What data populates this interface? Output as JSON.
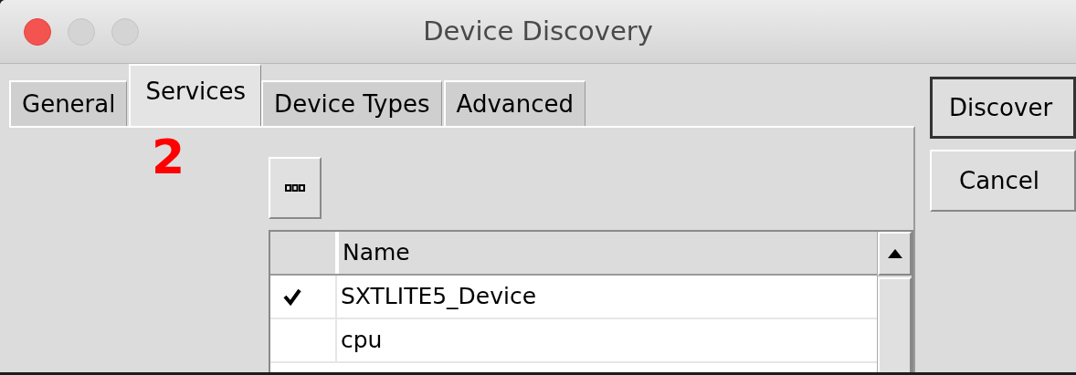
{
  "window": {
    "title": "Device Discovery"
  },
  "tabs": [
    {
      "label": "General",
      "selected": false
    },
    {
      "label": "Services",
      "selected": true
    },
    {
      "label": "Device Types",
      "selected": false
    },
    {
      "label": "Advanced",
      "selected": false
    }
  ],
  "annotation": "2",
  "table": {
    "columns": [
      "Name"
    ],
    "rows": [
      {
        "checked": true,
        "name": "SXTLITE5_Device"
      },
      {
        "checked": false,
        "name": "cpu"
      }
    ]
  },
  "buttons": [
    {
      "label": "Discover",
      "default": true
    },
    {
      "label": "Cancel",
      "default": false
    }
  ]
}
